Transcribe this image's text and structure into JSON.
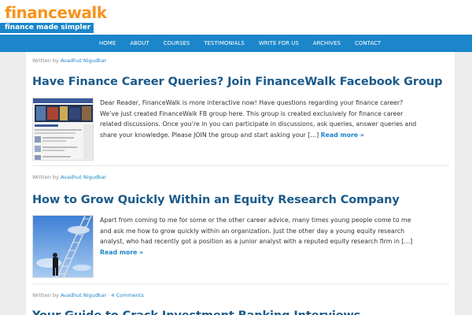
{
  "site": {
    "logo_text": "financewalk",
    "tagline": "finance made simpler"
  },
  "nav": {
    "items": [
      "HOME",
      "ABOUT",
      "COURSES",
      "TESTIMONIALS",
      "WRITE FOR US",
      "ARCHIVES",
      "CONTACT"
    ]
  },
  "posts": [
    {
      "written_by_label": "Written by",
      "author": "Avadhut Nigudkar",
      "comments": "",
      "title": "Have Finance Career Queries? Join FinanceWalk Facebook Group",
      "excerpt": "Dear Reader, FinanceWalk is more interactive now! Have questions regarding your finance career? We’ve just created FinanceWalk FB group here. This group is created exclusively for finance career related discussions. Once you’re in you can participate in discussions, ask queries, answer queries and share your knowledge. Please JOIN the group and start asking your […]",
      "read_more": "Read more »"
    },
    {
      "written_by_label": "Written by",
      "author": "Avadhut Nigudkar",
      "comments": "",
      "title": "How to Grow Quickly Within an Equity Research Company",
      "excerpt": "Apart from coming to me for some or the other career advice, many times young people come to me and ask me how to grow quickly within an organization. Just the other day a young equity research analyst, who had recently got a position as a junior analyst with a reputed equity research firm in […]",
      "read_more": "Read more »"
    },
    {
      "written_by_label": "Written by",
      "author": "Avadhut Nigudkar",
      "comments": "4 Comments",
      "title": "Your Guide to Crack Investment Banking Interviews",
      "excerpt": "",
      "read_more": ""
    }
  ],
  "colors": {
    "brand_orange": "#f7931e",
    "brand_blue": "#1b86c9",
    "title_blue": "#1a5a8a"
  }
}
